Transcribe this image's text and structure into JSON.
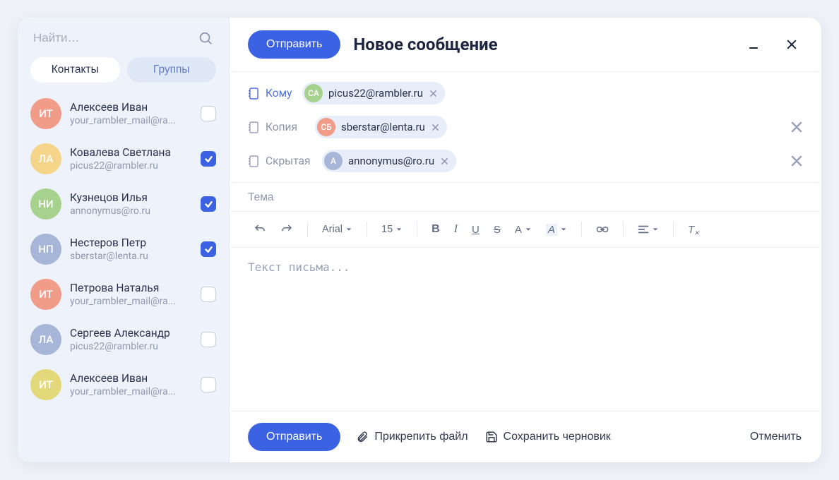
{
  "sidebar": {
    "search_placeholder": "Найти…",
    "tabs": {
      "contacts": "Контакты",
      "groups": "Группы"
    },
    "contacts": [
      {
        "initials": "ИТ",
        "name": "Алексеев Иван",
        "email": "your_rambler_mail@ra...",
        "avatar_class": "av-orange",
        "checked": false
      },
      {
        "initials": "ЛА",
        "name": "Ковалева Светлана",
        "email": "picus22@rambler.ru",
        "avatar_class": "av-yellow",
        "checked": true
      },
      {
        "initials": "НИ",
        "name": "Кузнецов Илья",
        "email": "annonymus@ro.ru",
        "avatar_class": "av-green",
        "checked": true
      },
      {
        "initials": "НП",
        "name": "Нестеров Петр",
        "email": "sberstar@lenta.ru",
        "avatar_class": "av-blue",
        "checked": true
      },
      {
        "initials": "ИТ",
        "name": "Петрова Наталья",
        "email": "your_rambler_mail@ra...",
        "avatar_class": "av-orange",
        "checked": false
      },
      {
        "initials": "ЛА",
        "name": "Сергеев Александр",
        "email": "picus22@rambler.ru",
        "avatar_class": "av-blue",
        "checked": false
      },
      {
        "initials": "ИТ",
        "name": "Алексеев Иван",
        "email": "your_rambler_mail@ra...",
        "avatar_class": "av-yellow2",
        "checked": false
      }
    ]
  },
  "compose": {
    "send_label": "Отправить",
    "title": "Новое сообщение",
    "recipients": {
      "to_label": "Кому",
      "to_chip": {
        "initials": "СА",
        "email": "picus22@rambler.ru"
      },
      "cc_label": "Копия",
      "cc_chip": {
        "initials": "СБ",
        "email": "sberstar@lenta.ru"
      },
      "bcc_label": "Скрытая",
      "bcc_chip": {
        "initials": "А",
        "email": "annonymus@ro.ru"
      }
    },
    "subject_placeholder": "Тема",
    "toolbar": {
      "font_name": "Arial",
      "font_size": "15"
    },
    "body_placeholder": "Текст письма...",
    "footer": {
      "send": "Отправить",
      "attach": "Прикрепить файл",
      "save_draft": "Сохранить черновик",
      "cancel": "Отменить"
    }
  }
}
